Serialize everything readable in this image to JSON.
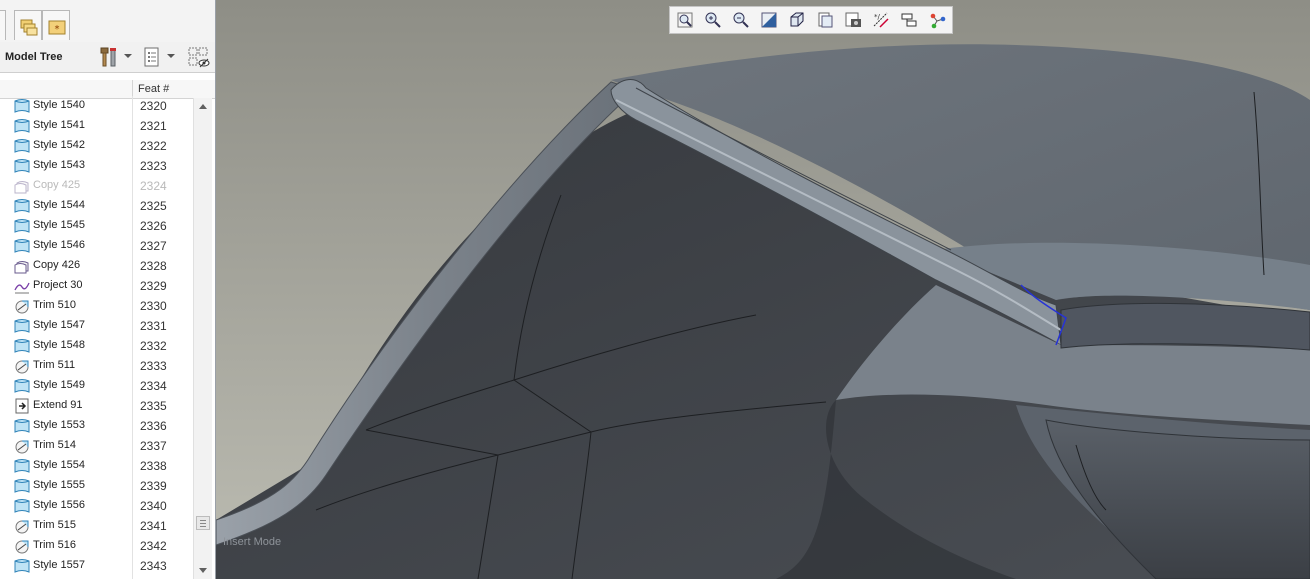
{
  "model_tree": {
    "title": "Model Tree",
    "column_header": "Feat #",
    "rows": [
      {
        "name": "Style 1540",
        "feat": "2320",
        "icon": "style-surface-icon"
      },
      {
        "name": "Style 1541",
        "feat": "2321",
        "icon": "style-surface-icon"
      },
      {
        "name": "Style 1542",
        "feat": "2322",
        "icon": "style-surface-icon"
      },
      {
        "name": "Style 1543",
        "feat": "2323",
        "icon": "style-surface-icon"
      },
      {
        "name": "Copy 425",
        "feat": "2324",
        "icon": "copy-icon",
        "suppressed": true
      },
      {
        "name": "Style 1544",
        "feat": "2325",
        "icon": "style-surface-icon"
      },
      {
        "name": "Style 1545",
        "feat": "2326",
        "icon": "style-surface-icon"
      },
      {
        "name": "Style 1546",
        "feat": "2327",
        "icon": "style-surface-icon"
      },
      {
        "name": "Copy 426",
        "feat": "2328",
        "icon": "copy-icon"
      },
      {
        "name": "Project 30",
        "feat": "2329",
        "icon": "project-curve-icon"
      },
      {
        "name": "Trim 510",
        "feat": "2330",
        "icon": "trim-icon"
      },
      {
        "name": "Style 1547",
        "feat": "2331",
        "icon": "style-surface-icon"
      },
      {
        "name": "Style 1548",
        "feat": "2332",
        "icon": "style-surface-icon"
      },
      {
        "name": "Trim 511",
        "feat": "2333",
        "icon": "trim-icon"
      },
      {
        "name": "Style 1549",
        "feat": "2334",
        "icon": "style-surface-icon"
      },
      {
        "name": "Extend 91",
        "feat": "2335",
        "icon": "extend-icon"
      },
      {
        "name": "Style 1553",
        "feat": "2336",
        "icon": "style-surface-icon"
      },
      {
        "name": "Trim 514",
        "feat": "2337",
        "icon": "trim-icon"
      },
      {
        "name": "Style 1554",
        "feat": "2338",
        "icon": "style-surface-icon"
      },
      {
        "name": "Style 1555",
        "feat": "2339",
        "icon": "style-surface-icon"
      },
      {
        "name": "Style 1556",
        "feat": "2340",
        "icon": "style-surface-icon"
      },
      {
        "name": "Trim 515",
        "feat": "2341",
        "icon": "trim-icon"
      },
      {
        "name": "Trim 516",
        "feat": "2342",
        "icon": "trim-icon"
      },
      {
        "name": "Style 1557",
        "feat": "2343",
        "icon": "style-surface-icon"
      }
    ]
  },
  "panel_tabs": [
    {
      "icon": "layers-icon"
    },
    {
      "icon": "folder-browser-icon"
    },
    {
      "icon": "favorites-icon"
    }
  ],
  "tree_toolbar_icons": [
    "settings-icon",
    "show-icon",
    "filter-icon"
  ],
  "view_toolbar": [
    {
      "icon": "refit-icon"
    },
    {
      "icon": "zoom-in-icon"
    },
    {
      "icon": "zoom-out-icon"
    },
    {
      "icon": "repaint-icon"
    },
    {
      "icon": "display-style-icon"
    },
    {
      "icon": "saved-views-icon"
    },
    {
      "icon": "view-manager-icon"
    },
    {
      "icon": "datum-display-icon"
    },
    {
      "icon": "annotation-display-icon"
    },
    {
      "icon": "spin-center-icon"
    }
  ],
  "status": {
    "mode": "Insert Mode"
  },
  "colors": {
    "viewport_background": "#aeaea4",
    "surface_light": "#7d848c",
    "surface_dark": "#3b3e43",
    "highlight_edge": "#2633d6"
  }
}
